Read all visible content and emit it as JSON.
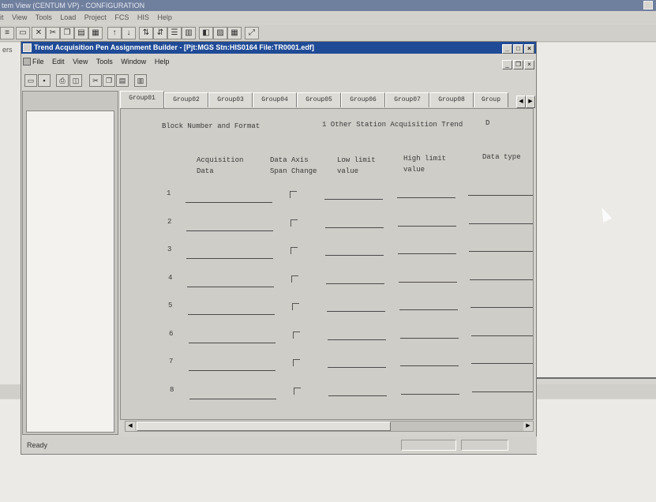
{
  "background_window": {
    "title": "tem View (CENTUM VP) - CONFIGURATION",
    "menu": [
      "it",
      "View",
      "Tools",
      "Load",
      "Project",
      "FCS",
      "HIS",
      "Help"
    ],
    "tree_fragments": [
      "ers"
    ]
  },
  "app": {
    "title": "Trend Acquisition Pen Assignment Builder - [Pjt:MGS Stn:HIS0164 File:TR0001.edf]",
    "menu": [
      "File",
      "Edit",
      "View",
      "Tools",
      "Window",
      "Help"
    ],
    "status": "Ready"
  },
  "tabs": [
    "Group01",
    "Group02",
    "Group03",
    "Group04",
    "Group05",
    "Group06",
    "Group07",
    "Group08",
    "Group"
  ],
  "form": {
    "block_label": "Block Number and Format",
    "block_value": "1 Other Station Acquisition Trend",
    "block_suffix": "D",
    "columns": {
      "acquisition_data": [
        "Acquisition",
        "Data"
      ],
      "span_change": [
        "Data Axis",
        "Span Change"
      ],
      "low_limit": [
        "Low limit",
        "value"
      ],
      "high_limit": [
        "High limit",
        "value"
      ],
      "data_type": [
        "Data type"
      ]
    },
    "rows": [
      "1",
      "2",
      "3",
      "4",
      "5",
      "6",
      "7",
      "8"
    ]
  },
  "colors": {
    "title_bar": "#1f4b96",
    "window_face": "#d5d3cd",
    "content_bg": "#cfcdc7"
  }
}
